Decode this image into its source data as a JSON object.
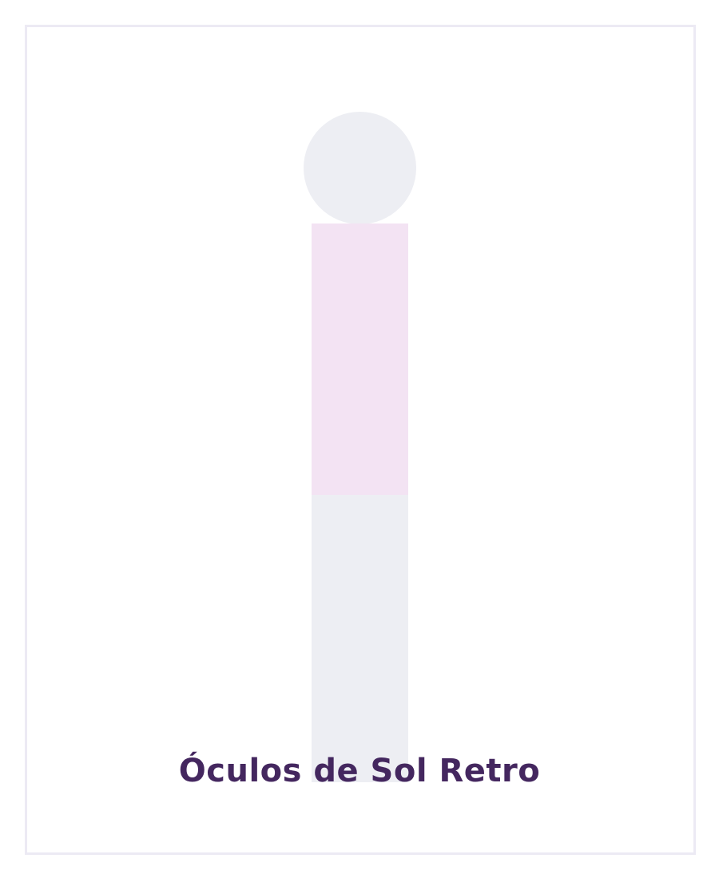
{
  "product": {
    "title": "Óculos de Sol Retro"
  },
  "colors": {
    "title": "#44275f",
    "frame_border": "#eceaf4",
    "figure_head": "#edeef3",
    "figure_torso": "#f3e3f3",
    "figure_legs": "#edeef3"
  }
}
